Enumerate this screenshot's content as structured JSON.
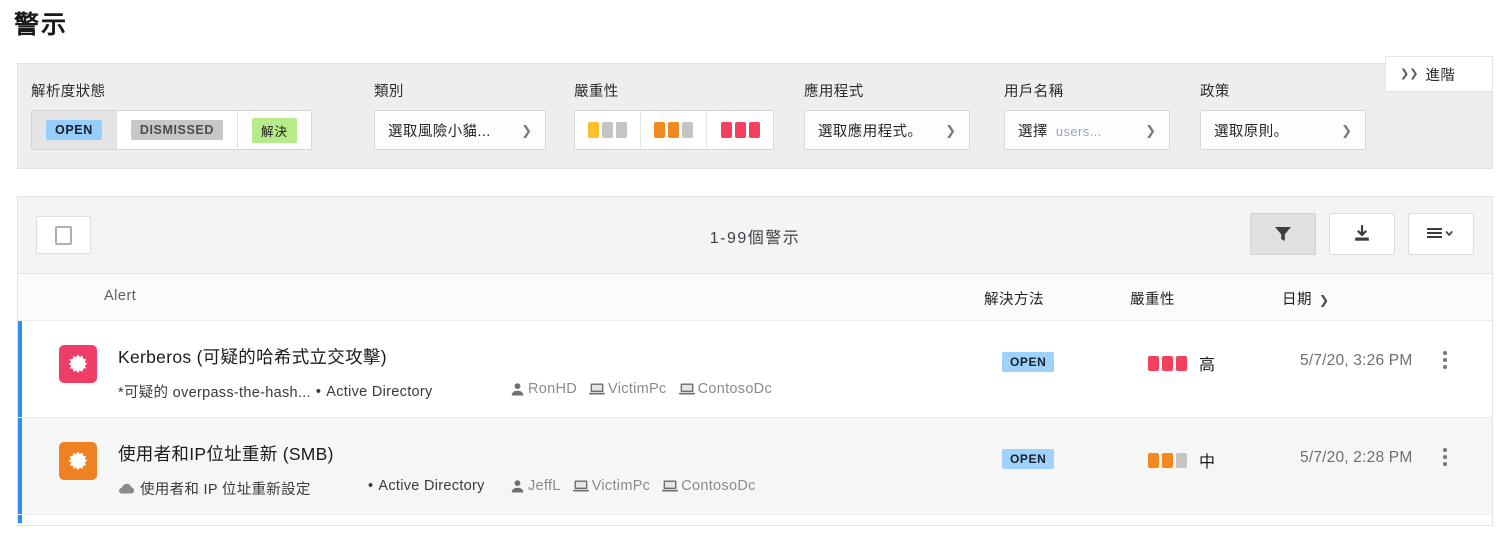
{
  "page": {
    "title": "警示"
  },
  "filters": {
    "resolution": {
      "label": "解析度狀態",
      "options": [
        {
          "id": "open",
          "label": "OPEN",
          "selected": true
        },
        {
          "id": "dismissed",
          "label": "DISMISSED",
          "selected": false
        },
        {
          "id": "resolved",
          "label": "解決",
          "selected": false
        }
      ]
    },
    "category": {
      "label": "類別",
      "value": "選取風險小貓...",
      "icon": "chevron-down-icon"
    },
    "severity": {
      "label": "嚴重性",
      "options": [
        {
          "id": "low",
          "filled": 1,
          "color": "#fcc02c"
        },
        {
          "id": "medium",
          "filled": 2,
          "color": "#f3881f"
        },
        {
          "id": "high",
          "filled": 3,
          "color": "#f43f5e"
        }
      ]
    },
    "app": {
      "label": "應用程式",
      "value": "選取應用程式。",
      "icon": "chevron-down-icon"
    },
    "username": {
      "label": "用戶名稱",
      "value": "選擇",
      "placeholder": "users...",
      "icon": "chevron-down-icon"
    },
    "policy": {
      "label": "政策",
      "value": "選取原則。",
      "icon": "chevron-down-icon"
    },
    "advanced": {
      "label": "進階",
      "icon": "double-chevron-down-icon"
    }
  },
  "toolbar": {
    "select_all_label": "select-all-checkbox",
    "count_text": "1-99個警示",
    "buttons": [
      {
        "id": "filter",
        "icon": "funnel-icon",
        "active": true
      },
      {
        "id": "export",
        "icon": "download-icon",
        "active": false
      },
      {
        "id": "columns",
        "icon": "list-menu-icon",
        "active": false
      }
    ]
  },
  "table": {
    "columns": {
      "alert": "Alert",
      "resolution": "解決方法",
      "severity": "嚴重性",
      "date": "日期",
      "date_sort_icon": "chevron-down-icon"
    },
    "rows": [
      {
        "icon": "starburst-icon",
        "icon_color": "#ee3e68",
        "title": "Kerberos (可疑的哈希式立交攻擊)",
        "subtitle": "*可疑的 overpass-the-hash...",
        "source": "Active Directory",
        "separator": "•",
        "entities": [
          {
            "icon": "user-icon",
            "name": "RonHD"
          },
          {
            "icon": "computer-icon",
            "name": "VictimPc"
          },
          {
            "icon": "computer-icon",
            "name": "ContosoDc"
          }
        ],
        "status": "OPEN",
        "severity_filled": 3,
        "severity_color": "#f43f5e",
        "severity_label": "高",
        "date": "5/7/20, 3:26 PM",
        "menu_icon": "kebab-menu-icon"
      },
      {
        "icon": "starburst-icon",
        "icon_color": "#f08122",
        "title": "使用者和IP位址重新 (SMB)",
        "subtitle_icon": "cloud-icon",
        "subtitle": "使用者和 IP 位址重新設定",
        "source": "Active Directory",
        "separator": "•",
        "entities": [
          {
            "icon": "user-icon",
            "name": "JeffL"
          },
          {
            "icon": "computer-icon",
            "name": "VictimPc"
          },
          {
            "icon": "computer-icon",
            "name": "ContosoDc"
          }
        ],
        "status": "OPEN",
        "severity_filled": 2,
        "severity_color": "#f3881f",
        "severity_label": "中",
        "date": "5/7/20, 2:28 PM",
        "menu_icon": "kebab-menu-icon"
      }
    ]
  },
  "colors": {
    "accent_blue": "#2f8ff0",
    "status_open_bg": "#9ed1fb",
    "severity_low": "#fcc02c",
    "severity_medium": "#f3881f",
    "severity_high": "#f43f5e",
    "severity_empty": "#c4c4c4"
  }
}
